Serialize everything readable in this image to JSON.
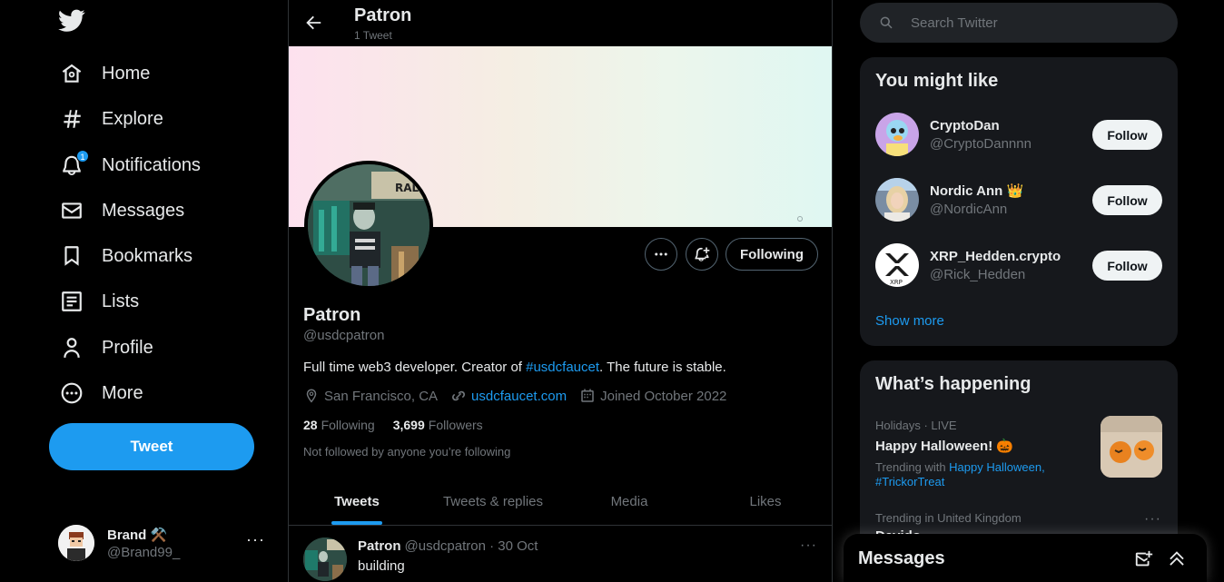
{
  "nav": {
    "items": [
      {
        "label": "Home",
        "icon": "home-icon"
      },
      {
        "label": "Explore",
        "icon": "hashtag-icon"
      },
      {
        "label": "Notifications",
        "icon": "bell-icon",
        "badge": "1"
      },
      {
        "label": "Messages",
        "icon": "envelope-icon"
      },
      {
        "label": "Bookmarks",
        "icon": "bookmark-icon"
      },
      {
        "label": "Lists",
        "icon": "list-icon"
      },
      {
        "label": "Profile",
        "icon": "person-icon"
      },
      {
        "label": "More",
        "icon": "more-circle-icon"
      }
    ],
    "tweet_button": "Tweet",
    "account": {
      "name": "Brand ⚒️",
      "handle": "@Brand99_",
      "menu": "···"
    }
  },
  "profile": {
    "header_title": "Patron",
    "header_subtitle": "1 Tweet",
    "name": "Patron",
    "handle": "@usdcpatron",
    "bio_prefix": "Full time web3 developer. Creator of ",
    "bio_tag": "#usdcfaucet",
    "bio_suffix": ". The future is stable.",
    "location": "San Francisco, CA",
    "website": "usdcfaucet.com",
    "joined": "Joined October 2022",
    "following_count": "28",
    "following_label": "Following",
    "followers_count": "3,699",
    "followers_label": "Followers",
    "not_followed": "Not followed by anyone you’re following",
    "following_button": "Following",
    "tabs": [
      "Tweets",
      "Tweets & replies",
      "Media",
      "Likes"
    ],
    "active_tab": "Tweets"
  },
  "tweet": {
    "name": "Patron",
    "handle_date": "@usdcpatron · 30 Oct",
    "text": "building"
  },
  "search": {
    "placeholder": "Search Twitter"
  },
  "you_might_like": {
    "title": "You might like",
    "users": [
      {
        "name": "CryptoDan",
        "handle": "@CryptoDannnn",
        "button": "Follow"
      },
      {
        "name": "Nordic Ann 👑",
        "handle": "@NordicAnn",
        "button": "Follow"
      },
      {
        "name": "XRP_Hedden.crypto",
        "handle": "@Rick_Hedden",
        "button": "Follow"
      }
    ],
    "show_more": "Show more"
  },
  "whats_happening": {
    "title": "What’s happening",
    "trends": [
      {
        "meta": "Holidays · LIVE",
        "name": "Happy Halloween! 🎃",
        "with_prefix": "Trending with ",
        "with_links": "Happy Halloween, #TrickorTreat"
      },
      {
        "meta": "Trending in United Kingdom",
        "name": "Davido"
      }
    ]
  },
  "messages_dock": {
    "title": "Messages"
  },
  "colors": {
    "accent": "#1d9bf0",
    "background": "#000000",
    "card": "#16181c",
    "muted": "#71767b"
  }
}
